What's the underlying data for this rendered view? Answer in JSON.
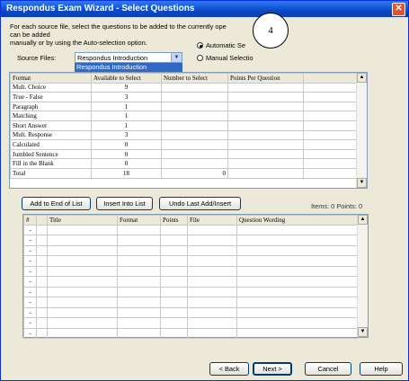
{
  "window": {
    "title": "Respondus Exam Wizard - Select Questions",
    "close_glyph": "✕"
  },
  "intro_text_left": "For each source file, select the questions to be added to the currently ope",
  "intro_text_right": "s can be added",
  "intro_text_line2": "manually or by using the Auto-selection option.",
  "callout_number": "4",
  "options": {
    "automatic": "Automatic Se",
    "manual": "Manual Selectio"
  },
  "source": {
    "label": "Source Files:",
    "value": "Respondus Introduction",
    "dropdown_option": "Respondus Introduction"
  },
  "top_table": {
    "headers": [
      "Format",
      "Available to Select",
      "Number to Select",
      "Points Per Question"
    ],
    "rows": [
      [
        "Mult. Choice",
        "9",
        "",
        ""
      ],
      [
        "True - False",
        "3",
        "",
        ""
      ],
      [
        "Paragraph",
        "1",
        "",
        ""
      ],
      [
        "Matching",
        "1",
        "",
        ""
      ],
      [
        "Short Answer",
        "1",
        "",
        ""
      ],
      [
        "Mult. Response",
        "3",
        "",
        ""
      ],
      [
        "Calculated",
        "0",
        "",
        ""
      ],
      [
        "Jumbled Sentence",
        "0",
        "",
        ""
      ],
      [
        "Fill in the Blank",
        "0",
        "",
        ""
      ],
      [
        "Total",
        "18",
        "0",
        ""
      ]
    ]
  },
  "actions": {
    "add_end": "Add to End of List",
    "insert": "Insert Into List",
    "undo": "Undo Last Add/Insert"
  },
  "status": "Items: 0  Points: 0",
  "bottom_table": {
    "headers": [
      "#",
      "",
      "Title",
      "Format",
      "Points",
      "File",
      "Question Wording"
    ],
    "row_marker": "-"
  },
  "footer": {
    "back": "< Back",
    "next": "Next >",
    "cancel": "Cancel",
    "help": "Help"
  }
}
